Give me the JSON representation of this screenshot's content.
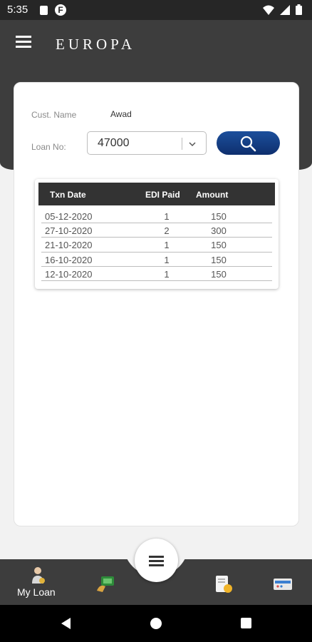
{
  "status_bar": {
    "time": "5:35"
  },
  "header": {
    "brand": "EUROPA"
  },
  "form": {
    "cust_name_label": "Cust. Name",
    "cust_name_value": "Awad",
    "loan_no_label": "Loan No:",
    "loan_no_value": "47000"
  },
  "table": {
    "headers": {
      "date": "Txn Date",
      "edi": "EDI Paid",
      "amount": "Amount"
    },
    "rows": [
      {
        "date": "05-12-2020",
        "edi": "1",
        "amount": "150"
      },
      {
        "date": "27-10-2020",
        "edi": "2",
        "amount": "300"
      },
      {
        "date": "21-10-2020",
        "edi": "1",
        "amount": "150"
      },
      {
        "date": "16-10-2020",
        "edi": "1",
        "amount": "150"
      },
      {
        "date": "12-10-2020",
        "edi": "1",
        "amount": "150"
      }
    ]
  },
  "bottom_nav": {
    "my_loan_label": "My Loan",
    "icons": [
      "user-coin-icon",
      "payment-icon",
      "menu-icon",
      "document-coin-icon",
      "card-reader-icon"
    ]
  },
  "colors": {
    "header": "#3d3d3d",
    "search_button": "#0e2f6e",
    "table_header": "#333333"
  }
}
